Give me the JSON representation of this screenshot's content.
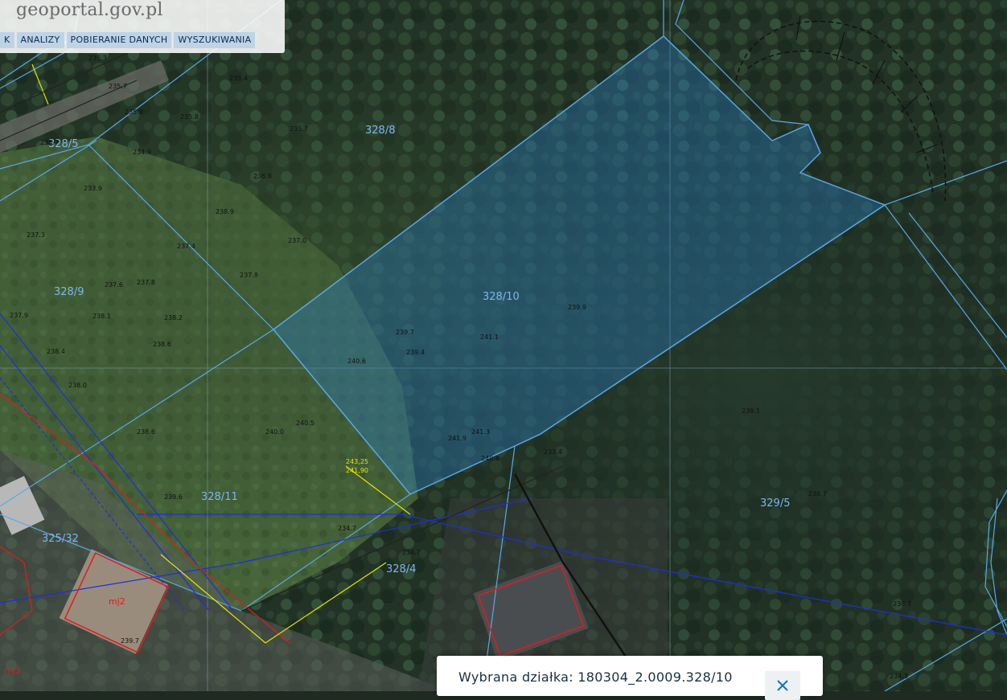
{
  "app": {
    "logo_text": "geoportal.gov.pl"
  },
  "menu": {
    "items": [
      {
        "label": "K"
      },
      {
        "label": "ANALIZY"
      },
      {
        "label": "POBIERANIE DANYCH"
      },
      {
        "label": "WYSZUKIWANIA"
      }
    ]
  },
  "map": {
    "parcels": [
      {
        "id": "328/8"
      },
      {
        "id": "328/10",
        "selected": true
      },
      {
        "id": "328/9"
      },
      {
        "id": "328/5"
      },
      {
        "id": "328/11"
      },
      {
        "id": "329/5"
      },
      {
        "id": "325/32"
      },
      {
        "id": "328/4"
      }
    ],
    "elevations": [
      "235.3",
      "235.7",
      "235.9",
      "235.8",
      "235.7",
      "235.4",
      "236.8",
      "235.7",
      "234.9",
      "233.9",
      "238.9",
      "237.0",
      "237.4",
      "237.8",
      "237.3",
      "237.6",
      "237.8",
      "238.2",
      "238.1",
      "237.9",
      "238.4",
      "238.6",
      "238.0",
      "238.6",
      "239.6",
      "240.0",
      "240.5",
      "239.7",
      "239.4",
      "240.6",
      "241.1",
      "241.3",
      "241.9",
      "240.8",
      "239.9",
      "239.1",
      "238.7",
      "238.3",
      "234.3",
      "233.4",
      "234.7",
      "234.7",
      "239.7"
    ],
    "utility_labels": [
      "243,25",
      "241,90",
      "mj2",
      "mj3"
    ],
    "colors": {
      "parcel_line": "#5aa8e6",
      "selection_fill": "#2a7fc4",
      "utility_blue": "#1e2ee0",
      "utility_red": "#e01c1c",
      "utility_yellow": "#e6e600",
      "utility_orange": "#e07820",
      "building_outline": "#111111"
    }
  },
  "selection_panel": {
    "text": "Wybrana działka: 180304_2.0009.328/10",
    "close_icon": "close-x-icon"
  }
}
